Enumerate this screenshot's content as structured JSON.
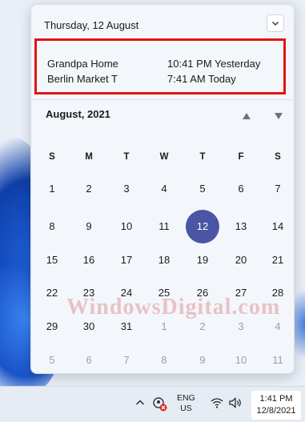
{
  "flyout": {
    "header_date": "Thursday, 12 August",
    "alarms": [
      {
        "name": "Grandpa Home",
        "time": "10:41 PM Yesterday"
      },
      {
        "name": "Berlin Market T",
        "time": "7:41 AM Today"
      }
    ]
  },
  "calendar": {
    "month_label": "August, 2021",
    "weekdays": [
      "S",
      "M",
      "T",
      "W",
      "T",
      "F",
      "S"
    ],
    "weeks": [
      [
        {
          "d": "1"
        },
        {
          "d": "2"
        },
        {
          "d": "3"
        },
        {
          "d": "4"
        },
        {
          "d": "5"
        },
        {
          "d": "6"
        },
        {
          "d": "7"
        }
      ],
      [
        {
          "d": "8"
        },
        {
          "d": "9"
        },
        {
          "d": "10"
        },
        {
          "d": "11"
        },
        {
          "d": "12",
          "today": true
        },
        {
          "d": "13"
        },
        {
          "d": "14"
        }
      ],
      [
        {
          "d": "15"
        },
        {
          "d": "16"
        },
        {
          "d": "17"
        },
        {
          "d": "18"
        },
        {
          "d": "19"
        },
        {
          "d": "20"
        },
        {
          "d": "21"
        }
      ],
      [
        {
          "d": "22"
        },
        {
          "d": "23"
        },
        {
          "d": "24"
        },
        {
          "d": "25"
        },
        {
          "d": "26"
        },
        {
          "d": "27"
        },
        {
          "d": "28"
        }
      ],
      [
        {
          "d": "29"
        },
        {
          "d": "30"
        },
        {
          "d": "31"
        },
        {
          "d": "1",
          "muted": true
        },
        {
          "d": "2",
          "muted": true
        },
        {
          "d": "3",
          "muted": true
        },
        {
          "d": "4",
          "muted": true
        }
      ],
      [
        {
          "d": "5",
          "muted": true
        },
        {
          "d": "6",
          "muted": true
        },
        {
          "d": "7",
          "muted": true
        },
        {
          "d": "8",
          "muted": true
        },
        {
          "d": "9",
          "muted": true
        },
        {
          "d": "10",
          "muted": true
        },
        {
          "d": "11",
          "muted": true
        }
      ]
    ]
  },
  "watermark": "WindowsDigital.com",
  "taskbar": {
    "lang_line1": "ENG",
    "lang_line2": "US",
    "time": "1:41 PM",
    "date": "12/8/2021",
    "icons": [
      "chevron-up-icon",
      "meet-now-icon",
      "wifi-icon",
      "speaker-icon"
    ]
  },
  "colors": {
    "today_highlight": "#4a56a4",
    "annotation_box": "#e01414"
  }
}
